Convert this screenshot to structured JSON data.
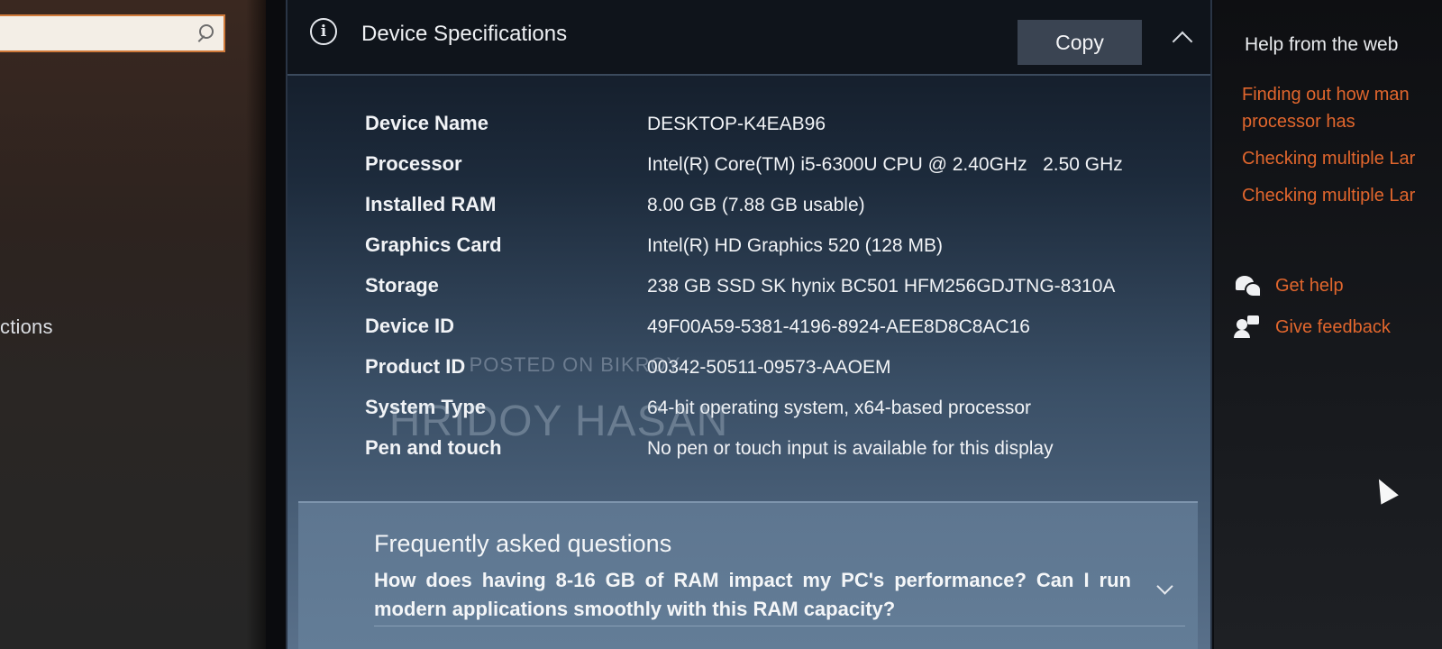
{
  "sidebar": {
    "search": {
      "value": "",
      "placeholder": ""
    },
    "partial_item_label": "ctions"
  },
  "panel": {
    "title": "Device Specifications",
    "copy_label": "Copy",
    "specs": [
      {
        "label": "Device Name",
        "value": "DESKTOP-K4EAB96"
      },
      {
        "label": "Processor",
        "value": "Intel(R) Core(TM) i5-6300U CPU @ 2.40GHz   2.50 GHz"
      },
      {
        "label": "Installed RAM",
        "value": "8.00 GB (7.88 GB usable)"
      },
      {
        "label": "Graphics Card",
        "value": "Intel(R) HD Graphics 520 (128 MB)"
      },
      {
        "label": "Storage",
        "value": "238 GB SSD SK hynix BC501 HFM256GDJTNG-8310A"
      },
      {
        "label": "Device ID",
        "value": "49F00A59-5381-4196-8924-AEE8D8C8AC16"
      },
      {
        "label": "Product ID",
        "value": "00342-50511-09573-AAOEM"
      },
      {
        "label": "System Type",
        "value": "64-bit operating system, x64-based processor"
      },
      {
        "label": "Pen and touch",
        "value": "No pen or touch input is available for this display"
      }
    ],
    "faq": {
      "heading": "Frequently asked questions",
      "question": "How does having 8-16 GB of RAM impact my PC's performance? Can I run modern applications smoothly with this RAM capacity?"
    }
  },
  "watermark": {
    "line1": "POSTED ON BIKROY",
    "line2": "HRIDOY HASAN"
  },
  "help": {
    "title": "Help from the web",
    "links": [
      "Finding out how man",
      "processor has",
      "Checking multiple Lar",
      "Checking multiple Lar"
    ],
    "get_help": "Get help",
    "give_feedback": "Give feedback"
  },
  "colors": {
    "accent_link": "#e1662d",
    "copy_button": "#3a4452",
    "search_border": "#d07a3a"
  },
  "icons": [
    "search-icon",
    "info-icon",
    "chevron-up-icon",
    "chevron-down-icon",
    "get-help-icon",
    "give-feedback-icon",
    "mouse-cursor-icon"
  ]
}
